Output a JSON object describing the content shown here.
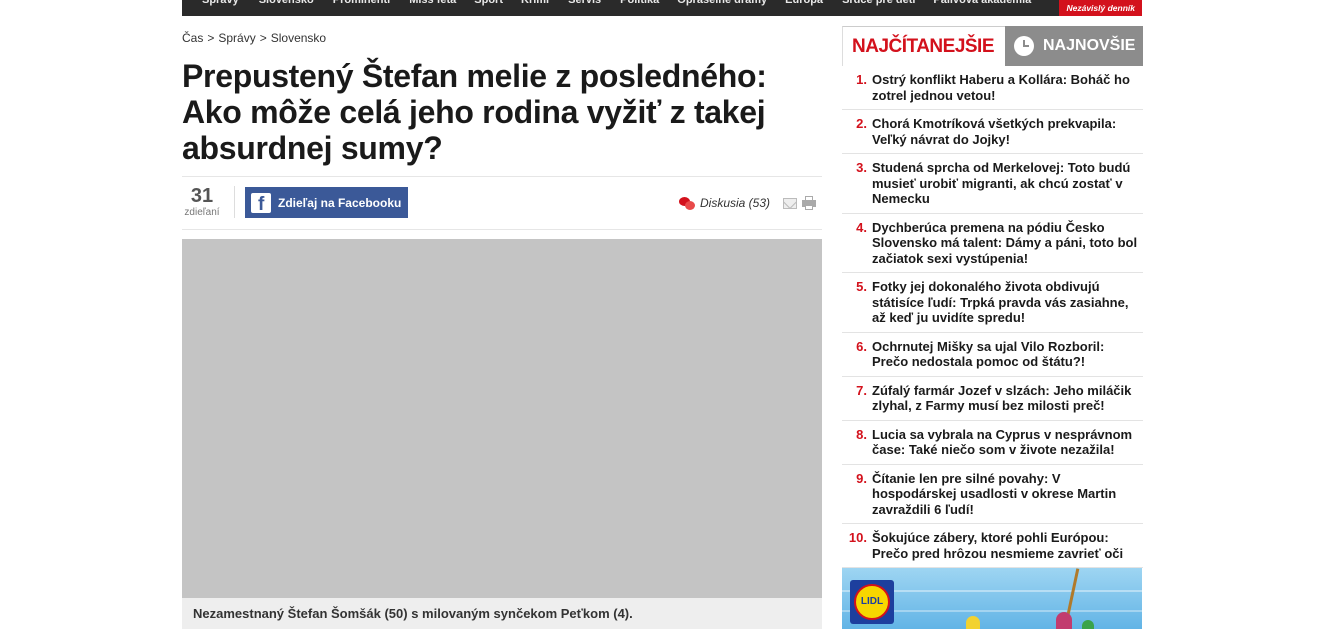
{
  "topnav": {
    "items": [
      "Správy",
      "Slovensko",
      "Prominenti",
      "Miss feta",
      "Šport",
      "Krimi",
      "Servis",
      "Politika",
      "Opraselné drámy",
      "Európa",
      "Srdce pre deti",
      "Palivová akadémia"
    ],
    "badge": "Nezávislý denník"
  },
  "breadcrumb": {
    "items": [
      "Čas",
      "Správy",
      "Slovensko"
    ],
    "separator": ">"
  },
  "article": {
    "title": "Prepustený Štefan melie z posledného: Ako môže celá jeho rodina vyžiť z takej absurdnej sumy?",
    "share_count": "31",
    "share_label": "zdieľaní",
    "facebook_label": "Zdieľaj na Facebooku",
    "discussion_label": "Diskusia (53)",
    "caption": "Nezamestnaný Štefan Šomšák (50) s milovaným synčekom Peťkom (4)."
  },
  "sidebar": {
    "tab_active": "NAJČÍTANEJŠIE",
    "tab_inactive": "NAJNOVŠIE",
    "items": [
      {
        "num": "1.",
        "text": "Ostrý konflikt Haberu a Kollára: Boháč ho zotrel jednou vetou!"
      },
      {
        "num": "2.",
        "text": "Chorá Kmotríková všetkých prekvapila: Veľký návrat do Jojky!"
      },
      {
        "num": "3.",
        "text": "Studená sprcha od Merkelovej: Toto budú musieť urobiť migranti, ak chcú zostať v Nemecku"
      },
      {
        "num": "4.",
        "text": "Dychberúca premena na pódiu Česko Slovensko má talent: Dámy a páni, toto bol začiatok sexi vystúpenia!"
      },
      {
        "num": "5.",
        "text": "Fotky jej dokonalého života obdivujú státisíce ľudí: Trpká pravda vás zasiahne, až keď ju uvidíte spredu!"
      },
      {
        "num": "6.",
        "text": "Ochrnutej Mišky sa ujal Vilo Rozboril: Prečo nedostala pomoc od štátu?!"
      },
      {
        "num": "7.",
        "text": "Zúfalý farmár Jozef v slzách: Jeho miláčik zlyhal, z Farmy musí bez milosti preč!"
      },
      {
        "num": "8.",
        "text": "Lucia sa vybrala na Cyprus v nesprávnom čase: Také niečo som v živote nezažila!"
      },
      {
        "num": "9.",
        "text": "Čítanie len pre silné povahy: V hospodárskej usadlosti v okrese Martin zavraždili 6 ľudí!"
      },
      {
        "num": "10.",
        "text": "Šokujúce zábery, ktoré pohli Európou: Prečo pred hrôzou nesmieme zavrieť oči"
      }
    ]
  },
  "ad": {
    "brand": "LIDL"
  },
  "colors": {
    "accent": "#d3111c",
    "facebook": "#3b5998",
    "nav": "#2a2a2a",
    "image_placeholder": "#c4c4c4"
  }
}
